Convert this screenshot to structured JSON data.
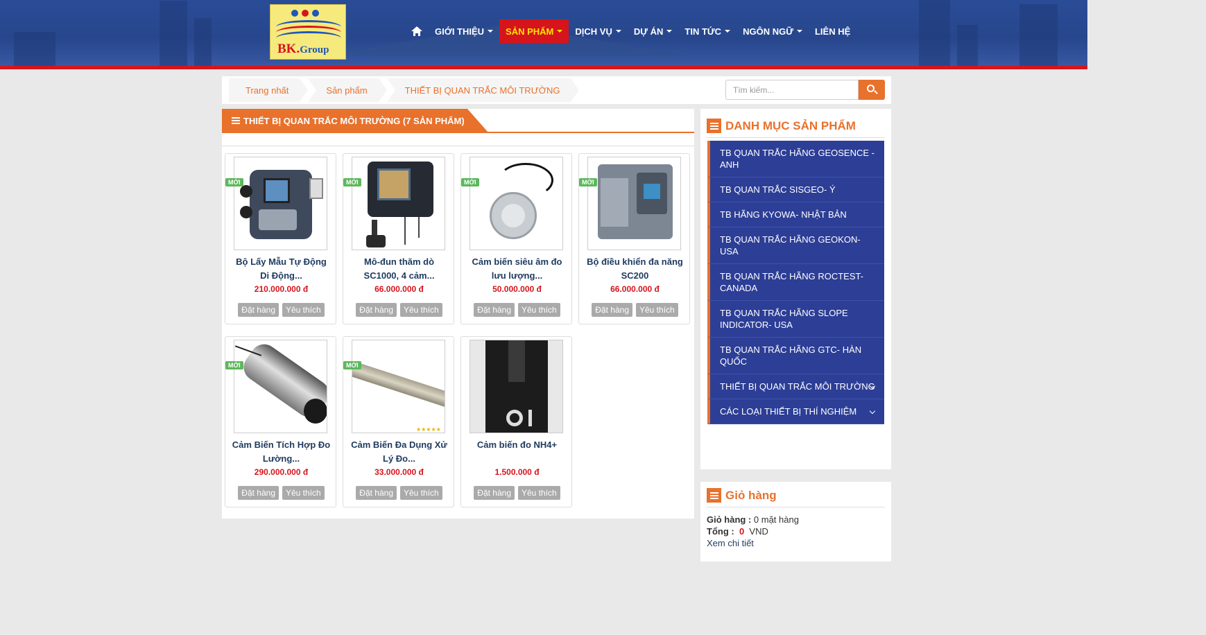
{
  "logo": {
    "brand_main": "BK.",
    "brand_sub": "Group"
  },
  "nav": {
    "items": [
      {
        "label": "GIỚI THIỆU",
        "caret": true
      },
      {
        "label": "SẢN PHẨM",
        "caret": true,
        "active": true
      },
      {
        "label": "DỊCH VỤ",
        "caret": true
      },
      {
        "label": "DỰ ÁN",
        "caret": true
      },
      {
        "label": "TIN TỨC",
        "caret": true
      },
      {
        "label": "NGÔN NGỮ",
        "caret": true
      },
      {
        "label": "LIÊN HỆ",
        "caret": false
      }
    ]
  },
  "breadcrumb": [
    "Trang nhất",
    "Sản phẩm",
    "THIẾT BỊ QUAN TRẮC MÔI TRƯỜNG"
  ],
  "search": {
    "placeholder": "Tìm kiếm..."
  },
  "category_title": "THIẾT BỊ QUAN TRẮC MÔI TRƯỜNG (7 SẢN PHẨM)",
  "badge_label": "MỚI",
  "order_label": "Đặt hàng",
  "wishlist_label": "Yêu thích",
  "products": [
    {
      "name": "Bộ Lấy Mẫu Tự Động Di Động...",
      "price": "210.000.000 đ",
      "new": true
    },
    {
      "name": "Mô-đun thăm dò SC1000, 4 cảm...",
      "price": "66.000.000 đ",
      "new": true
    },
    {
      "name": "Cảm biến siêu âm đo lưu lượng...",
      "price": "50.000.000 đ",
      "new": true
    },
    {
      "name": "Bộ điều khiển đa năng SC200",
      "price": "66.000.000 đ",
      "new": true
    },
    {
      "name": "Cảm Biến Tích Hợp Đo Lường...",
      "price": "290.000.000 đ",
      "new": true
    },
    {
      "name": "Cảm Biến Đa Dụng Xử Lý Đo...",
      "price": "33.000.000 đ",
      "new": true
    },
    {
      "name": "Cảm biến đo NH4+",
      "price": "1.500.000 đ",
      "new": false
    }
  ],
  "sidebar": {
    "title": "DANH MỤC SẢN PHẨM",
    "items": [
      {
        "label": "TB QUAN TRẮC HÃNG GEOSENCE - ANH",
        "chevron": false
      },
      {
        "label": "TB QUAN TRẮC SISGEO- Ý",
        "chevron": false
      },
      {
        "label": "TB HÃNG KYOWA- NHẬT BẢN",
        "chevron": false
      },
      {
        "label": "TB QUAN TRẮC HÃNG GEOKON- USA",
        "chevron": false
      },
      {
        "label": "TB QUAN TRẮC HÃNG ROCTEST- CANADA",
        "chevron": false
      },
      {
        "label": "TB QUAN TRẮC HÃNG SLOPE INDICATOR- USA",
        "chevron": false
      },
      {
        "label": "TB QUAN TRẮC HÃNG GTC- HÀN QUỐC",
        "chevron": false
      },
      {
        "label": "THIẾT BỊ QUAN TRẮC MÔI TRƯỜNG",
        "chevron": true
      },
      {
        "label": "CÁC LOẠI THIẾT BỊ THÍ NGHIỆM",
        "chevron": true
      }
    ]
  },
  "cart": {
    "title": "Giỏ hàng",
    "items_label": "Giỏ hàng :",
    "items_value": "0 mặt hàng",
    "total_label": "Tổng :",
    "total_value": "0",
    "currency": "VND",
    "detail_link": "Xem chi tiết"
  },
  "colors": {
    "accent": "#e8712c",
    "nav_active": "#d6141b",
    "sidebar_bg": "#2c3e96",
    "price": "#d6141b",
    "badge": "#5cb85c"
  }
}
